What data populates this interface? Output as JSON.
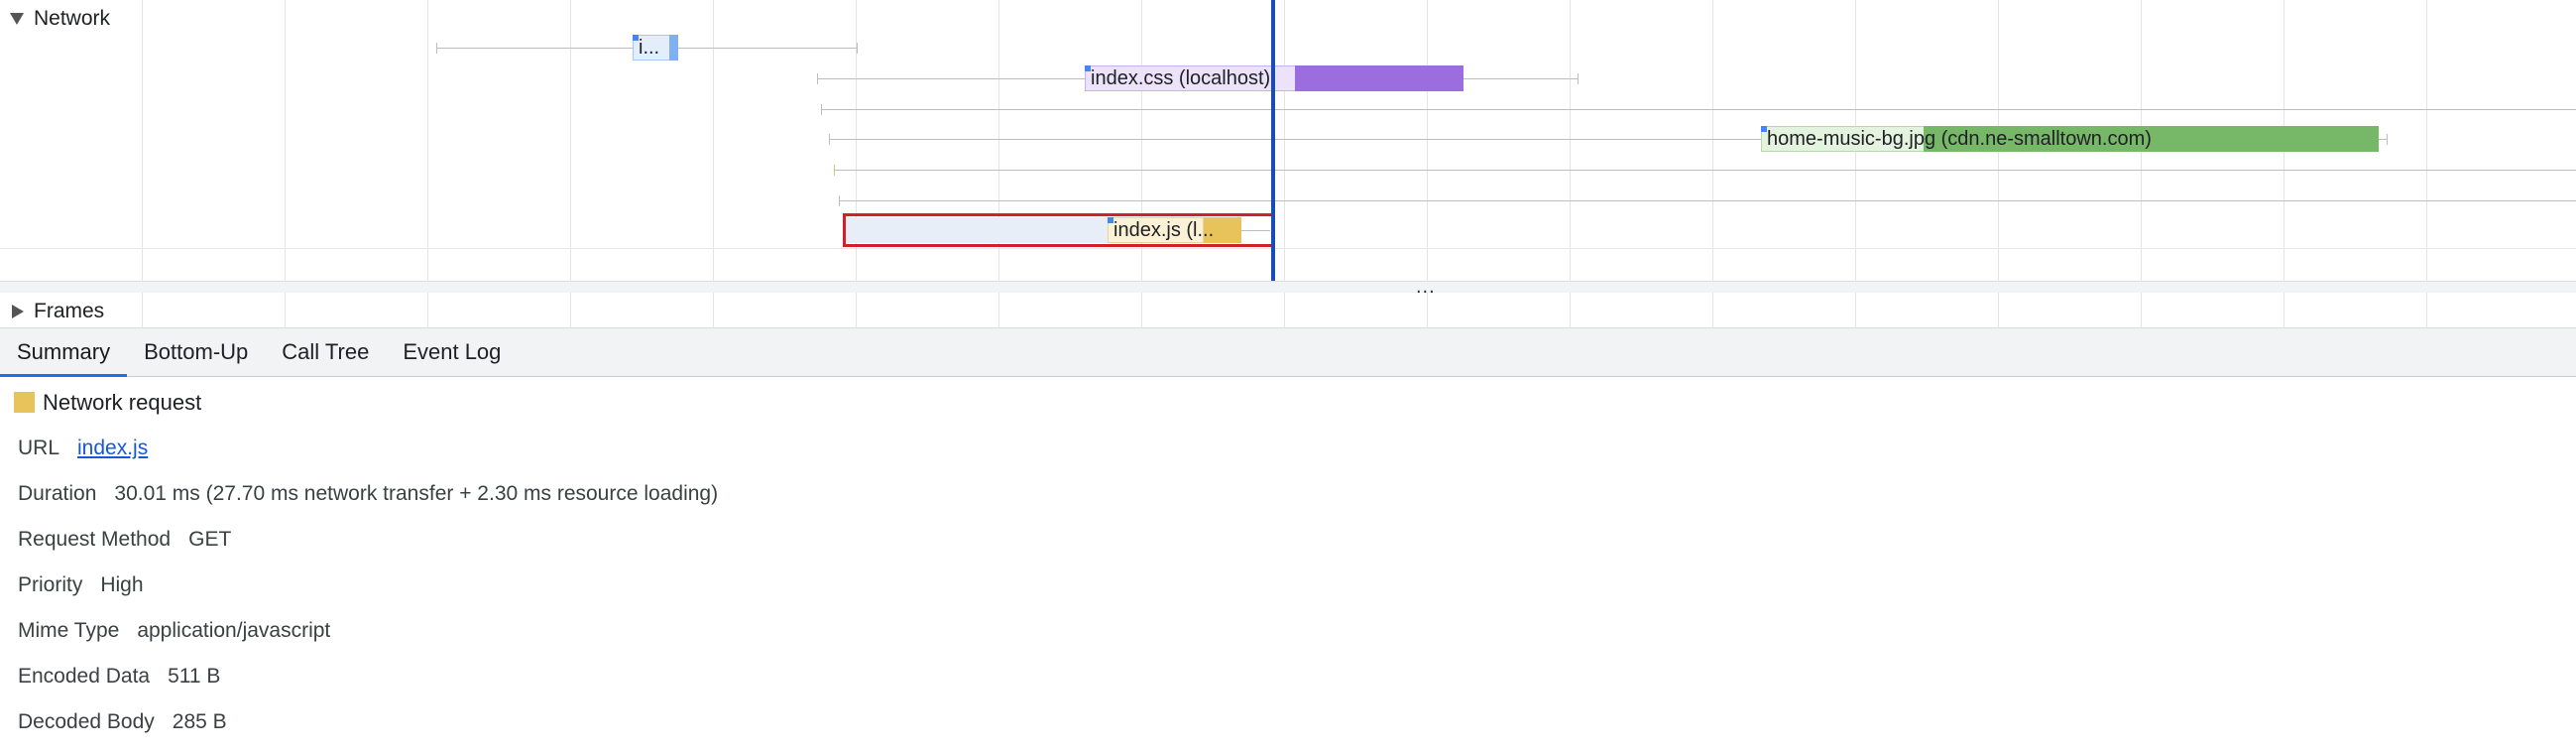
{
  "timeline": {
    "network_label": "Network",
    "frames_label": "Frames",
    "divider_glyph": "...",
    "requests": [
      {
        "label": "i...",
        "color": "#7fb0ef"
      },
      {
        "label": "index.css (localhost)",
        "color": "#9b6ddf"
      },
      {
        "label": "home-music-bg.jpg (cdn.ne-smalltown.com)",
        "color": "#77b868"
      },
      {
        "label": "index.js (l...",
        "color": "#e8c25b"
      }
    ]
  },
  "tabs": [
    "Summary",
    "Bottom-Up",
    "Call Tree",
    "Event Log"
  ],
  "summary": {
    "title": "Network request",
    "swatch_color": "#e8c25b",
    "url_label": "URL",
    "url_value": "index.js",
    "duration_label": "Duration",
    "duration_value": "30.01 ms (27.70 ms network transfer + 2.30 ms resource loading)",
    "method_label": "Request Method",
    "method_value": "GET",
    "priority_label": "Priority",
    "priority_value": "High",
    "mime_label": "Mime Type",
    "mime_value": "application/javascript",
    "encoded_label": "Encoded Data",
    "encoded_value": "511 B",
    "decoded_label": "Decoded Body",
    "decoded_value": "285 B"
  }
}
